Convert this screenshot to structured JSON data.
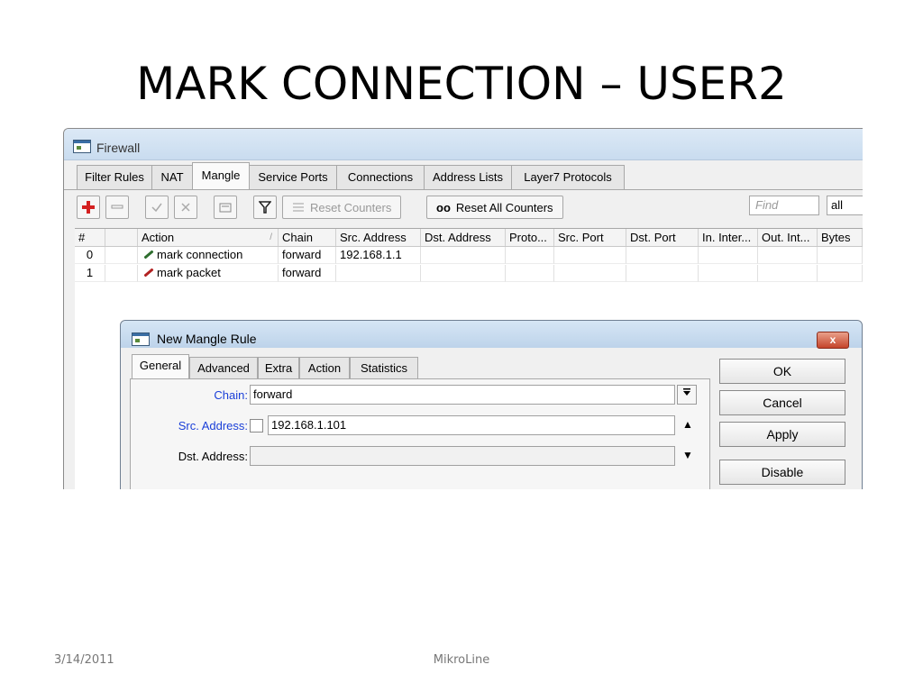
{
  "slide": {
    "title": "MARK CONNECTION – USER2",
    "date": "3/14/2011",
    "footer": "MikroLine"
  },
  "firewall": {
    "window_title": "Firewall",
    "tabs": [
      "Filter Rules",
      "NAT",
      "Mangle",
      "Service Ports",
      "Connections",
      "Address Lists",
      "Layer7 Protocols"
    ],
    "active_tab": "Mangle",
    "toolbar": {
      "reset_counters": "Reset Counters",
      "reset_all_counters": "Reset All Counters",
      "reset_all_prefix": "oo",
      "find_placeholder": "Find",
      "filter_value": "all"
    },
    "columns": [
      "#",
      "",
      "Action",
      "Chain",
      "Src. Address",
      "Dst. Address",
      "Proto...",
      "Src. Port",
      "Dst. Port",
      "In. Inter...",
      "Out. Int...",
      "Bytes"
    ],
    "rows": [
      {
        "num": "0",
        "action": "mark connection",
        "chain": "forward",
        "src": "192.168.1.1"
      },
      {
        "num": "1",
        "action": "mark packet",
        "chain": "forward",
        "src": ""
      }
    ],
    "sort_indicator": "/"
  },
  "dialog": {
    "title": "New Mangle Rule",
    "close_label": "x",
    "tabs": [
      "General",
      "Advanced",
      "Extra",
      "Action",
      "Statistics"
    ],
    "active_tab": "General",
    "fields": {
      "chain_label": "Chain:",
      "chain_value": "forward",
      "src_label": "Src. Address:",
      "src_value": "192.168.1.101",
      "dst_label": "Dst. Address:",
      "dst_value": ""
    },
    "buttons": {
      "ok": "OK",
      "cancel": "Cancel",
      "apply": "Apply",
      "disable": "Disable"
    }
  },
  "colors": {
    "label_blue": "#1a3fd8",
    "add_red": "#d42020",
    "close_red": "#c5442b"
  }
}
